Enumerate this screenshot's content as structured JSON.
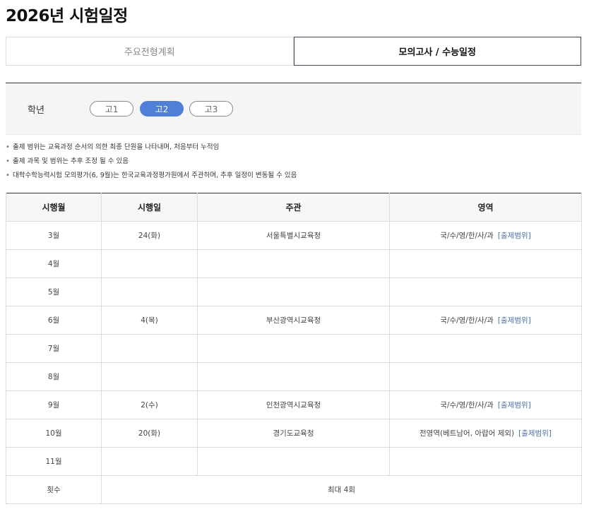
{
  "page_title": "2026년 시험일정",
  "tabs": [
    {
      "label": "주요전형계획",
      "active": false
    },
    {
      "label": "모의고사 / 수능일정",
      "active": true
    }
  ],
  "filter": {
    "label": "학년",
    "grades": [
      {
        "label": "고1",
        "selected": false
      },
      {
        "label": "고2",
        "selected": true
      },
      {
        "label": "고3",
        "selected": false
      }
    ]
  },
  "notes": [
    "출제 범위는 교육과정 순서의 의한 최종 단원을 나타내며, 처음부터 누적임",
    "출제 과목 및 범위는 추후 조정 될 수 있음",
    "대학수학능력시험 모의평가(6, 9월)는 한국교육과정평가원에서 주관하며, 추후 일정이 변동될 수 있음"
  ],
  "table": {
    "headers": [
      "시행월",
      "시행일",
      "주관",
      "영역"
    ],
    "rows": [
      {
        "month": "3월",
        "date": "24(화)",
        "org": "서울특별시교육청",
        "area": "국/수/영/한/사/과",
        "link": "[출제범위]"
      },
      {
        "month": "4월",
        "date": "",
        "org": "",
        "area": "",
        "link": ""
      },
      {
        "month": "5월",
        "date": "",
        "org": "",
        "area": "",
        "link": ""
      },
      {
        "month": "6월",
        "date": "4(목)",
        "org": "부산광역시교육청",
        "area": "국/수/영/한/사/과",
        "link": "[출제범위]"
      },
      {
        "month": "7월",
        "date": "",
        "org": "",
        "area": "",
        "link": ""
      },
      {
        "month": "8월",
        "date": "",
        "org": "",
        "area": "",
        "link": ""
      },
      {
        "month": "9월",
        "date": "2(수)",
        "org": "인천광역시교육청",
        "area": "국/수/영/한/사/과",
        "link": "[출제범위]"
      },
      {
        "month": "10월",
        "date": "20(화)",
        "org": "경기도교육청",
        "area": "전영역(베트남어, 아랍어 제외)",
        "link": "[출제범위]"
      },
      {
        "month": "11월",
        "date": "",
        "org": "",
        "area": "",
        "link": ""
      }
    ],
    "footer": {
      "label": "횟수",
      "value": "최대 4회"
    }
  }
}
